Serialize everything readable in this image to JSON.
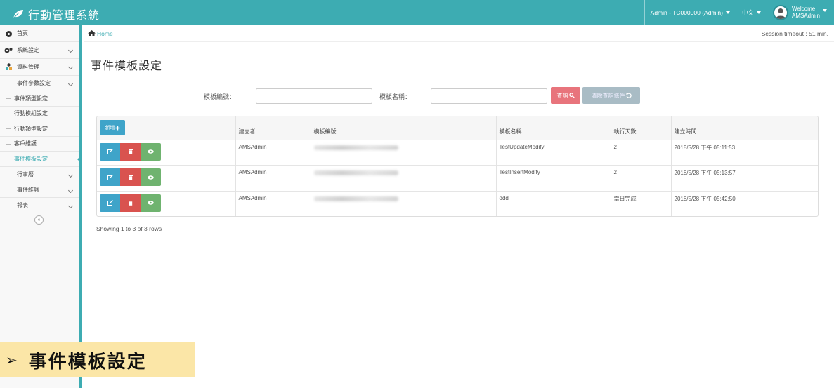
{
  "app": {
    "title": "行動管理系統"
  },
  "topnav": {
    "admin": "Admin - TC000000 (Admin)",
    "lang": "中文",
    "welcome": "Welcome",
    "user": "AMSAdmin"
  },
  "sidebar": {
    "items": [
      {
        "label": "首頁"
      },
      {
        "label": "系統設定"
      },
      {
        "label": "資料管理"
      },
      {
        "label": "事件參數設定"
      },
      {
        "label": "事件類型設定"
      },
      {
        "label": "行動模組設定"
      },
      {
        "label": "行動類型設定"
      },
      {
        "label": "客戶維護"
      },
      {
        "label": "事件模板設定"
      },
      {
        "label": "行事曆"
      },
      {
        "label": "事件維護"
      },
      {
        "label": "報表"
      }
    ],
    "collapse": "«"
  },
  "breadcrumb": {
    "home": "Home"
  },
  "session": "Session timeout : 51 min.",
  "page": {
    "title": "事件模板設定"
  },
  "search": {
    "code_label": "模板編號：",
    "name_label": "模板名稱：",
    "search_btn": "查詢",
    "clear_btn": "清除查詢條件"
  },
  "table": {
    "new_btn": "新增",
    "columns": [
      "建立者",
      "模板編號",
      "模板名稱",
      "執行天數",
      "建立時間"
    ],
    "rows": [
      {
        "creator": "AMSAdmin",
        "name": "TestUpdateModify",
        "days": "2",
        "created": "2018/5/28 下午 05:11:53"
      },
      {
        "creator": "AMSAdmin",
        "name": "TestInsertModify",
        "days": "2",
        "created": "2018/5/28 下午 05:13:57"
      },
      {
        "creator": "AMSAdmin",
        "name": "ddd",
        "days": "當日完成",
        "created": "2018/5/28 下午 05:42:50"
      }
    ],
    "footer": "Showing 1 to 3 of 3 rows"
  },
  "caption": {
    "arrow": "➢",
    "text": "事件模板設定"
  },
  "colors": {
    "accent": "#3dacb2",
    "search": "#e8747c",
    "edit": "#3fa4c9",
    "delete": "#d9534f",
    "view": "#6fb36f"
  }
}
